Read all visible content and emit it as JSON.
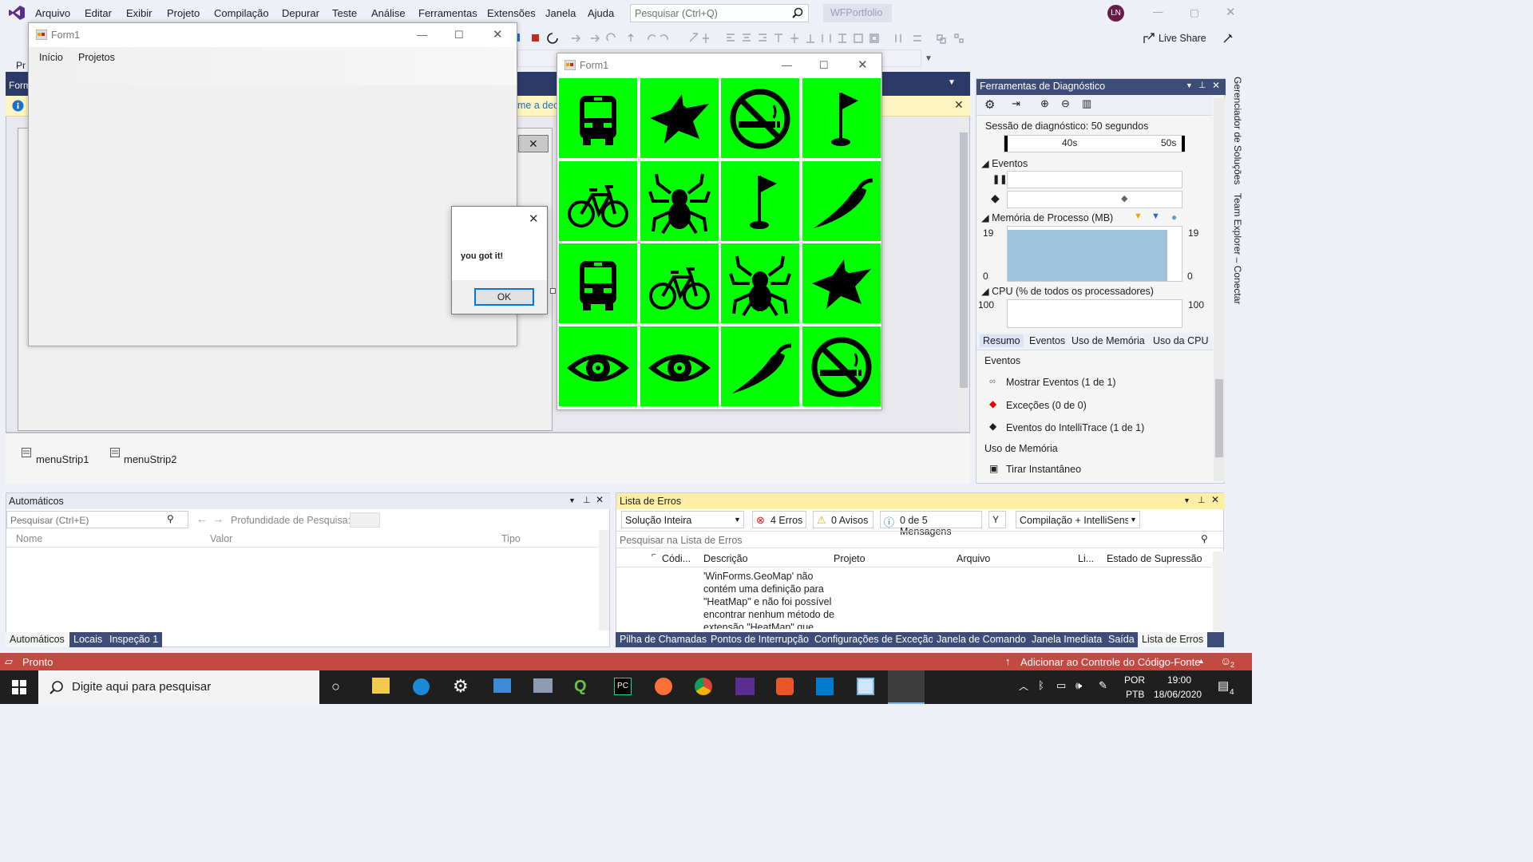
{
  "menubar": {
    "items": [
      "Arquivo",
      "Editar",
      "Exibir",
      "Projeto",
      "Compilação",
      "Depurar",
      "Teste",
      "Análise",
      "Ferramentas",
      "Extensões",
      "Janela",
      "Ajuda"
    ],
    "search_placeholder": "Pesquisar (Ctrl+Q)",
    "project_name": "WFPortfolio",
    "avatar_initials": "LN"
  },
  "toolbar": {
    "live_share": "Live Share",
    "partial_label": "Pr"
  },
  "designer": {
    "tab_partial": "Form",
    "info_partial": "me a dec",
    "tray_items": [
      "menuStrip1",
      "menuStrip2"
    ]
  },
  "form_a": {
    "title": "Form1",
    "menu": [
      "Início",
      "Projetos"
    ]
  },
  "form_b": {
    "title": "Form1",
    "grid": [
      [
        "bus-icon",
        "superhero-icon",
        "no-smoking-icon",
        "golf-flag-icon"
      ],
      [
        "bicycle-icon",
        "spider-icon",
        "golf-flag-icon",
        "chili-pepper-icon"
      ],
      [
        "bus-icon",
        "bicycle-icon",
        "spider-icon",
        "superhero-icon"
      ],
      [
        "eye-icon",
        "eye-icon",
        "chili-pepper-icon",
        "no-smoking-icon"
      ]
    ],
    "cell_color": "#00ff00"
  },
  "message_box": {
    "text": "you got it!",
    "ok_label": "OK"
  },
  "diagnostics": {
    "title": "Ferramentas de Diagnóstico",
    "session": "Sessão de diagnóstico: 50 segundos",
    "timeline_labels": [
      "40s",
      "50s"
    ],
    "events_label": "Eventos",
    "memory_label": "Memória de Processo (MB)",
    "memory_max": "19",
    "memory_min": "0",
    "cpu_label": "CPU (% de todos os processadores)",
    "cpu_max": "100",
    "tabs": [
      "Resumo",
      "Eventos",
      "Uso de Memória",
      "Uso da CPU"
    ],
    "events_heading": "Eventos",
    "event_items": [
      "Mostrar Eventos (1 de 1)",
      "Exceções (0 de 0)",
      "Eventos do IntelliTrace (1 de 1)"
    ],
    "memory_heading": "Uso de Memória",
    "snapshot": "Tirar Instantâneo"
  },
  "right_tabs": [
    "Gerenciador de Soluções",
    "Team Explorer – Conectar"
  ],
  "autos": {
    "title": "Automáticos",
    "search_placeholder": "Pesquisar (Ctrl+E)",
    "depth_label": "Profundidade de Pesquisa:",
    "columns": [
      "Nome",
      "Valor",
      "Tipo"
    ],
    "tabs": [
      "Automáticos",
      "Locais",
      "Inspeção 1"
    ]
  },
  "errors": {
    "title": "Lista de Erros",
    "scope": "Solução Inteira",
    "errors_count": "4 Erros",
    "warnings_count": "0 Avisos",
    "messages_count": "0 de 5 Mensagens",
    "build_filter": "Compilação + IntelliSens",
    "search_placeholder": "Pesquisar na Lista de Erros",
    "columns": [
      "Códi...",
      "Descrição",
      "Projeto",
      "Arquivo",
      "Li...",
      "Estado de Supressão"
    ],
    "row_description": "'WinForms.GeoMap' não contém uma definição para \"HeatMap\" e não foi possível encontrar nenhum método de extensão \"HeatMap\" que",
    "tabs": [
      "Pilha de Chamadas",
      "Pontos de Interrupção",
      "Configurações de Exceção",
      "Janela de Comando",
      "Janela Imediata",
      "Saída",
      "Lista de Erros"
    ]
  },
  "status": {
    "ready": "Pronto",
    "source_control": "Adicionar ao Controle do Código-Fonte",
    "notifications": "2"
  },
  "taskbar": {
    "search_placeholder": "Digite aqui para pesquisar",
    "lang": "POR",
    "layout": "PTB",
    "time": "19:00",
    "date": "18/06/2020",
    "notif_count": "4"
  }
}
